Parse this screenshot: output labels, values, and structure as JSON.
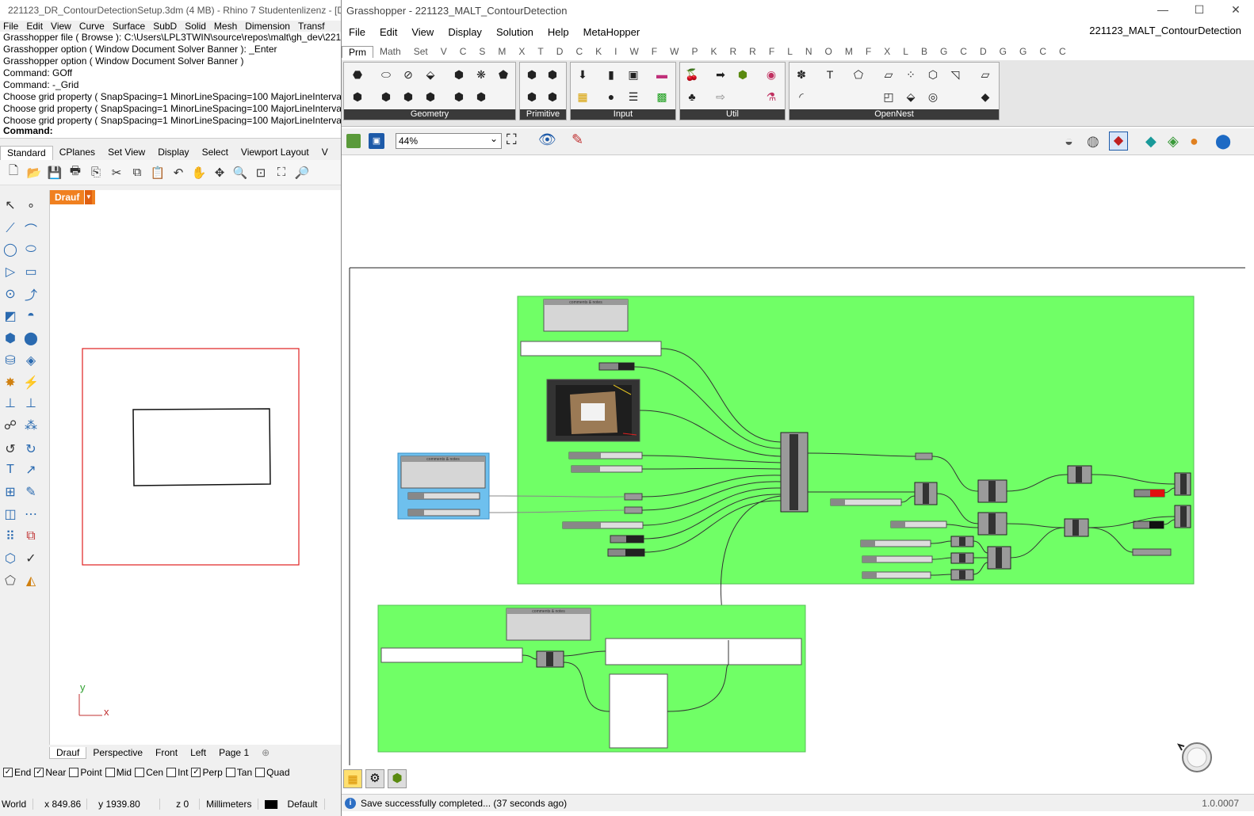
{
  "rhino": {
    "title": "221123_DR_ContourDetectionSetup.3dm (4 MB) - Rhino 7 Studentenlizenz - [D",
    "menu": [
      "File",
      "Edit",
      "View",
      "Curve",
      "Surface",
      "SubD",
      "Solid",
      "Mesh",
      "Dimension",
      "Transf"
    ],
    "command_history": [
      "Grasshopper file ( Browse ): C:\\Users\\LPL3TWIN\\source\\repos\\malt\\gh_dev\\221",
      "Grasshopper option ( Window  Document  Solver  Banner ): _Enter",
      "Grasshopper option ( Window  Document  Solver  Banner )",
      "Command: GOff",
      "Command: -_Grid",
      "Choose grid property ( SnapSpacing=1  MinorLineSpacing=100  MajorLineInterva",
      "Choose grid property ( SnapSpacing=1  MinorLineSpacing=100  MajorLineInterva",
      "Choose grid property ( SnapSpacing=1  MinorLineSpacing=100  MajorLineInterva"
    ],
    "command_prompt": "Command:",
    "toolbar_tabs": [
      "Standard",
      "CPlanes",
      "Set View",
      "Display",
      "Select",
      "Viewport Layout",
      "V"
    ],
    "viewport_label": "Drauf",
    "axis_x": "x",
    "axis_y": "y",
    "viewport_tabs": [
      "Drauf",
      "Perspective",
      "Front",
      "Left",
      "Page 1",
      "⊕"
    ],
    "osnaps": [
      {
        "label": "End",
        "checked": true
      },
      {
        "label": "Near",
        "checked": true
      },
      {
        "label": "Point",
        "checked": false
      },
      {
        "label": "Mid",
        "checked": false
      },
      {
        "label": "Cen",
        "checked": false
      },
      {
        "label": "Int",
        "checked": false
      },
      {
        "label": "Perp",
        "checked": true
      },
      {
        "label": "Tan",
        "checked": false
      },
      {
        "label": "Quad",
        "checked": false
      }
    ],
    "status": {
      "cplane": "World",
      "x": "x 849.86",
      "y": "y 1939.80",
      "z": "z 0",
      "units": "Millimeters",
      "layer": "Default"
    }
  },
  "grasshopper": {
    "title": "Grasshopper - 221123_MALT_ContourDetection",
    "window_controls": [
      "—",
      "☐",
      "✕"
    ],
    "menu": [
      "File",
      "Edit",
      "View",
      "Display",
      "Solution",
      "Help",
      "MetaHopper"
    ],
    "document_name": "221123_MALT_ContourDetection",
    "tabs": [
      "Prm",
      "Math",
      "Set",
      "V",
      "C",
      "S",
      "M",
      "X",
      "T",
      "D",
      "C",
      "K",
      "I",
      "W",
      "F",
      "W",
      "P",
      "K",
      "R",
      "R",
      "F",
      "L",
      "N",
      "O",
      "M",
      "F",
      "X",
      "L",
      "B",
      "G",
      "C",
      "D",
      "G",
      "G",
      "C",
      "C"
    ],
    "ribbon_groups": [
      "Geometry",
      "Primitive",
      "Input",
      "Util",
      "OpenNest"
    ],
    "zoom": "44%",
    "group_labels": [
      "comments & notes",
      "comments & notes",
      "comments & notes"
    ],
    "status_text": "Save successfully completed... (37 seconds ago)",
    "version": "1.0.0007"
  }
}
